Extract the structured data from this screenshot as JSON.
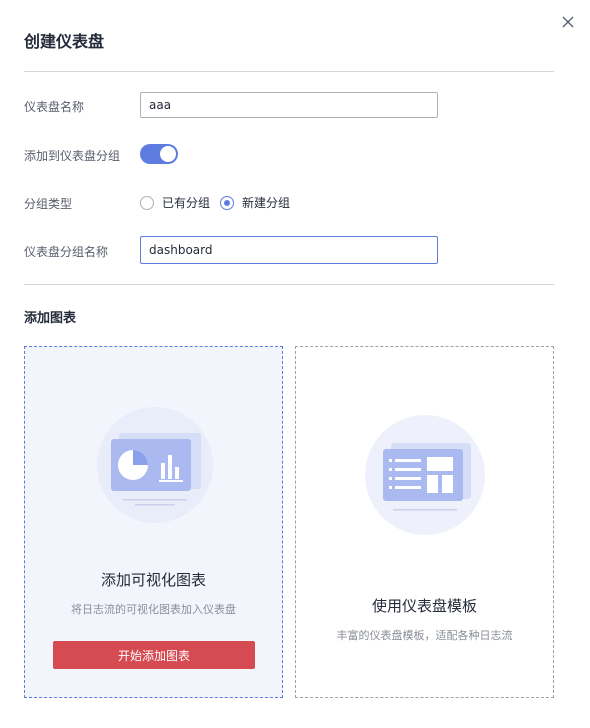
{
  "dialog": {
    "title": "创建仪表盘"
  },
  "form": {
    "name_label": "仪表盘名称",
    "name_value": "aaa",
    "add_group_label": "添加到仪表盘分组",
    "add_group_on": true,
    "group_type_label": "分组类型",
    "group_options": [
      "已有分组",
      "新建分组"
    ],
    "group_selected": "新建分组",
    "group_name_label": "仪表盘分组名称",
    "group_name_value": "dashboard"
  },
  "charts_section": {
    "title": "添加图表",
    "cards": [
      {
        "title": "添加可视化图表",
        "description": "将日志流的可视化图表加入仪表盘",
        "button_label": "开始添加图表"
      },
      {
        "title": "使用仪表盘模板",
        "description": "丰富的仪表盘模板，适配各种日志流"
      }
    ]
  },
  "colors": {
    "accent": "#5e7ce0",
    "button": "#d64a52"
  }
}
